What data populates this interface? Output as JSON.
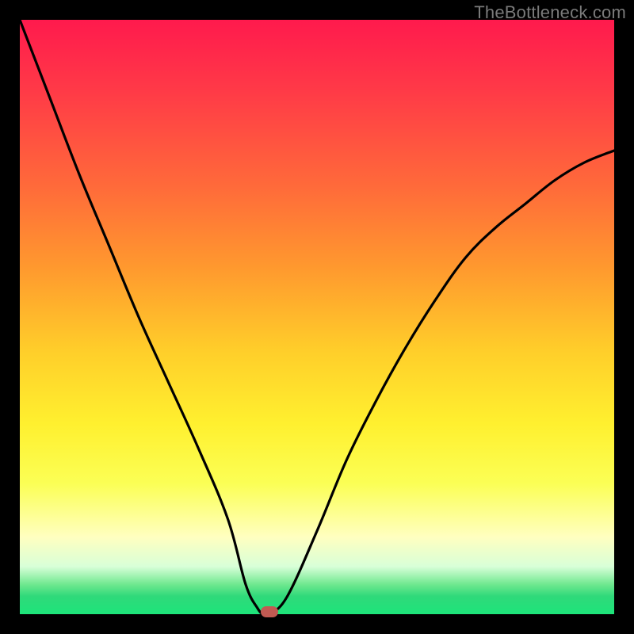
{
  "watermark": "TheBottleneck.com",
  "colors": {
    "frame": "#000000",
    "curve": "#000000",
    "marker": "#c15a52"
  },
  "chart_data": {
    "type": "line",
    "title": "",
    "xlabel": "",
    "ylabel": "",
    "xlim": [
      0,
      100
    ],
    "ylim": [
      0,
      100
    ],
    "grid": false,
    "x": [
      0,
      5,
      10,
      15,
      20,
      25,
      30,
      35,
      38,
      40,
      41,
      42,
      45,
      50,
      55,
      60,
      65,
      70,
      75,
      80,
      85,
      90,
      95,
      100
    ],
    "values": [
      100,
      87,
      74,
      62,
      50,
      39,
      28,
      16,
      5,
      1,
      0,
      0,
      3,
      14,
      26,
      36,
      45,
      53,
      60,
      65,
      69,
      73,
      76,
      78
    ],
    "marker": {
      "x": 42,
      "y": 0
    },
    "gradient_stops": [
      {
        "pos": 0,
        "color": "#ff1a4d"
      },
      {
        "pos": 12,
        "color": "#ff3a47"
      },
      {
        "pos": 28,
        "color": "#ff6a3a"
      },
      {
        "pos": 42,
        "color": "#ff9a2e"
      },
      {
        "pos": 56,
        "color": "#ffcf2a"
      },
      {
        "pos": 68,
        "color": "#fff02f"
      },
      {
        "pos": 78,
        "color": "#fbff55"
      },
      {
        "pos": 87,
        "color": "#ffffc0"
      },
      {
        "pos": 92,
        "color": "#d8ffd8"
      },
      {
        "pos": 95,
        "color": "#6fe88f"
      },
      {
        "pos": 97,
        "color": "#2fd97a"
      },
      {
        "pos": 100,
        "color": "#1de47a"
      }
    ]
  }
}
